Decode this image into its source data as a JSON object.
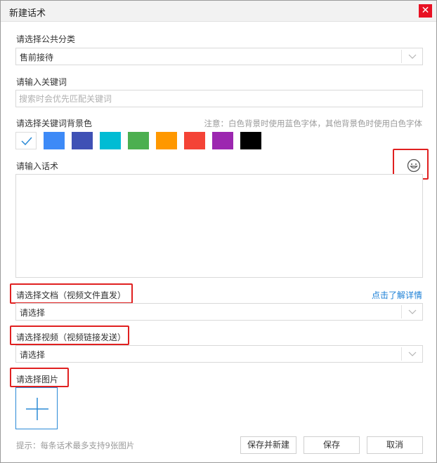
{
  "window": {
    "title": "新建话术",
    "close_glyph": "✕"
  },
  "category": {
    "label": "请选择公共分类",
    "value": "售前接待"
  },
  "keyword": {
    "label": "请输入关键词",
    "placeholder": "搜索时会优先匹配关键词"
  },
  "bgcolor": {
    "label": "请选择关键词背景色",
    "note": "注意：白色背景时使用蓝色字体，其他背景色时使用白色字体",
    "selected": "#ffffff",
    "swatches": [
      "#ffffff",
      "#3d8af7",
      "#3f51b5",
      "#00bcd4",
      "#4caf50",
      "#ff9800",
      "#f44336",
      "#9c27b0",
      "#000000"
    ]
  },
  "script": {
    "label": "请输入话术",
    "emoji_icon": "smiley-icon",
    "value": ""
  },
  "document": {
    "label": "请选择文档（视频文件直发）",
    "link": "点击了解详情",
    "value": "请选择"
  },
  "video": {
    "label": "请选择视频（视频链接发送）",
    "value": "请选择"
  },
  "image": {
    "label": "请选择图片",
    "upload_icon": "plus-icon"
  },
  "footer": {
    "hint": "提示：每条话术最多支持9张图片",
    "save_new_label": "保存并新建",
    "save_label": "保存",
    "cancel_label": "取消"
  },
  "colors": {
    "accent": "#1a7fd6",
    "highlight_border": "#e02020",
    "close": "#e81123"
  }
}
